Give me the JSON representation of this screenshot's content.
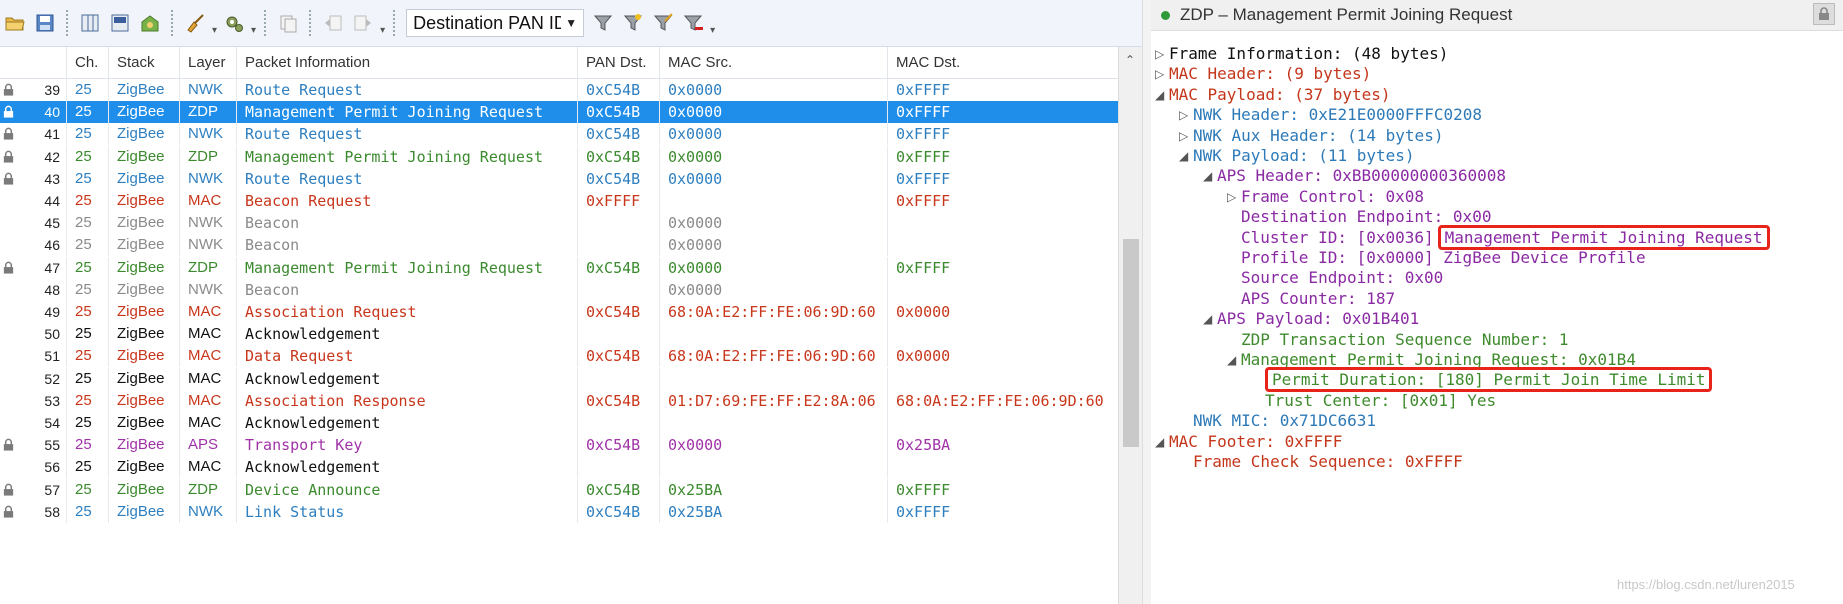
{
  "toolbar": {
    "pan_selector_value": "Destination PAN ID",
    "pan_selector_display": "Destination PAN ID"
  },
  "columns": {
    "ch": "Ch.",
    "stack": "Stack",
    "layer": "Layer",
    "info": "Packet Information",
    "pan_dst": "PAN Dst.",
    "mac_src": "MAC Src.",
    "mac_dst": "MAC Dst."
  },
  "packets": [
    {
      "num": "39",
      "ch": "25",
      "stack": "ZigBee",
      "layer": "NWK",
      "info": "Route Request",
      "pan": "0xC54B",
      "src": "0x0000",
      "dst": "0xFFFF",
      "locked": true,
      "kind": "nwk"
    },
    {
      "num": "40",
      "ch": "25",
      "stack": "ZigBee",
      "layer": "ZDP",
      "info": "Management Permit Joining Request",
      "pan": "0xC54B",
      "src": "0x0000",
      "dst": "0xFFFF",
      "locked": true,
      "kind": "zdp",
      "selected": true
    },
    {
      "num": "41",
      "ch": "25",
      "stack": "ZigBee",
      "layer": "NWK",
      "info": "Route Request",
      "pan": "0xC54B",
      "src": "0x0000",
      "dst": "0xFFFF",
      "locked": true,
      "kind": "nwk"
    },
    {
      "num": "42",
      "ch": "25",
      "stack": "ZigBee",
      "layer": "ZDP",
      "info": "Management Permit Joining Request",
      "pan": "0xC54B",
      "src": "0x0000",
      "dst": "0xFFFF",
      "locked": true,
      "kind": "zdp"
    },
    {
      "num": "43",
      "ch": "25",
      "stack": "ZigBee",
      "layer": "NWK",
      "info": "Route Request",
      "pan": "0xC54B",
      "src": "0x0000",
      "dst": "0xFFFF",
      "locked": true,
      "kind": "nwk"
    },
    {
      "num": "44",
      "ch": "25",
      "stack": "ZigBee",
      "layer": "MAC",
      "info": "Beacon Request",
      "pan": "0xFFFF",
      "src": "",
      "dst": "0xFFFF",
      "locked": false,
      "kind": "mac"
    },
    {
      "num": "45",
      "ch": "25",
      "stack": "ZigBee",
      "layer": "NWK",
      "info": "Beacon",
      "pan": "",
      "src": "0x0000",
      "dst": "",
      "locked": false,
      "kind": "gray"
    },
    {
      "num": "46",
      "ch": "25",
      "stack": "ZigBee",
      "layer": "NWK",
      "info": "Beacon",
      "pan": "",
      "src": "0x0000",
      "dst": "",
      "locked": false,
      "kind": "gray"
    },
    {
      "num": "47",
      "ch": "25",
      "stack": "ZigBee",
      "layer": "ZDP",
      "info": "Management Permit Joining Request",
      "pan": "0xC54B",
      "src": "0x0000",
      "dst": "0xFFFF",
      "locked": true,
      "kind": "zdp"
    },
    {
      "num": "48",
      "ch": "25",
      "stack": "ZigBee",
      "layer": "NWK",
      "info": "Beacon",
      "pan": "",
      "src": "0x0000",
      "dst": "",
      "locked": false,
      "kind": "gray"
    },
    {
      "num": "49",
      "ch": "25",
      "stack": "ZigBee",
      "layer": "MAC",
      "info": "Association Request",
      "pan": "0xC54B",
      "src": "68:0A:E2:FF:FE:06:9D:60",
      "dst": "0x0000",
      "locked": false,
      "kind": "mac"
    },
    {
      "num": "50",
      "ch": "25",
      "stack": "ZigBee",
      "layer": "MAC",
      "info": "Acknowledgement",
      "pan": "",
      "src": "",
      "dst": "",
      "locked": false,
      "kind": "black"
    },
    {
      "num": "51",
      "ch": "25",
      "stack": "ZigBee",
      "layer": "MAC",
      "info": "Data Request",
      "pan": "0xC54B",
      "src": "68:0A:E2:FF:FE:06:9D:60",
      "dst": "0x0000",
      "locked": false,
      "kind": "mac"
    },
    {
      "num": "52",
      "ch": "25",
      "stack": "ZigBee",
      "layer": "MAC",
      "info": "Acknowledgement",
      "pan": "",
      "src": "",
      "dst": "",
      "locked": false,
      "kind": "black"
    },
    {
      "num": "53",
      "ch": "25",
      "stack": "ZigBee",
      "layer": "MAC",
      "info": "Association Response",
      "pan": "0xC54B",
      "src": "01:D7:69:FE:FF:E2:8A:06",
      "dst": "68:0A:E2:FF:FE:06:9D:60",
      "locked": false,
      "kind": "mac"
    },
    {
      "num": "54",
      "ch": "25",
      "stack": "ZigBee",
      "layer": "MAC",
      "info": "Acknowledgement",
      "pan": "",
      "src": "",
      "dst": "",
      "locked": false,
      "kind": "black"
    },
    {
      "num": "55",
      "ch": "25",
      "stack": "ZigBee",
      "layer": "APS",
      "info": "Transport Key",
      "pan": "0xC54B",
      "src": "0x0000",
      "dst": "0x25BA",
      "locked": true,
      "kind": "aps"
    },
    {
      "num": "56",
      "ch": "25",
      "stack": "ZigBee",
      "layer": "MAC",
      "info": "Acknowledgement",
      "pan": "",
      "src": "",
      "dst": "",
      "locked": false,
      "kind": "black"
    },
    {
      "num": "57",
      "ch": "25",
      "stack": "ZigBee",
      "layer": "ZDP",
      "info": "Device Announce",
      "pan": "0xC54B",
      "src": "0x25BA",
      "dst": "0xFFFF",
      "locked": true,
      "kind": "zdp"
    },
    {
      "num": "58",
      "ch": "25",
      "stack": "ZigBee",
      "layer": "NWK",
      "info": "Link Status",
      "pan": "0xC54B",
      "src": "0x25BA",
      "dst": "0xFFFF",
      "locked": true,
      "kind": "nwk"
    }
  ],
  "details": {
    "title": "ZDP – Management Permit Joining Request",
    "tree": [
      {
        "text": "Frame Information: (48 bytes)",
        "color": "black",
        "level": 0,
        "toggle": "collapsed"
      },
      {
        "text": "MAC Header: (9 bytes)",
        "color": "red",
        "level": 0,
        "toggle": "collapsed"
      },
      {
        "text": "MAC Payload: (37 bytes)",
        "color": "red",
        "level": 0,
        "toggle": "expanded"
      },
      {
        "text": "NWK Header: 0xE21E0000FFFC0208",
        "color": "blue",
        "level": 1,
        "toggle": "collapsed"
      },
      {
        "text": "NWK Aux Header: (14 bytes)",
        "color": "blue",
        "level": 1,
        "toggle": "collapsed"
      },
      {
        "text": "NWK Payload: (11 bytes)",
        "color": "blue",
        "level": 1,
        "toggle": "expanded"
      },
      {
        "text": "APS Header: 0xBB00000000360008",
        "color": "purple",
        "level": 2,
        "toggle": "expanded"
      },
      {
        "text": "Frame Control: 0x08",
        "color": "purple",
        "level": 3,
        "toggle": "collapsed"
      },
      {
        "text": "Destination Endpoint: 0x00",
        "color": "purple",
        "level": 3,
        "toggle": "none"
      },
      {
        "text": "Cluster ID: [0x0036]",
        "hl": "Management Permit Joining Request",
        "color": "purple",
        "level": 3,
        "toggle": "none"
      },
      {
        "text": "Profile ID: [0x0000] ZigBee Device Profile",
        "color": "purple",
        "level": 3,
        "toggle": "none"
      },
      {
        "text": "Source Endpoint: 0x00",
        "color": "purple",
        "level": 3,
        "toggle": "none"
      },
      {
        "text": "APS Counter: 187",
        "color": "purple",
        "level": 3,
        "toggle": "none"
      },
      {
        "text": "APS Payload: 0x01B401",
        "color": "purple",
        "level": 2,
        "toggle": "expanded"
      },
      {
        "text": "ZDP Transaction Sequence Number: 1",
        "color": "green",
        "level": 3,
        "toggle": "none"
      },
      {
        "text": "Management Permit Joining Request: 0x01B4",
        "color": "green",
        "level": 3,
        "toggle": "expanded"
      },
      {
        "text": "",
        "hl": "Permit Duration: [180] Permit Join Time Limit",
        "color": "green",
        "level": 4,
        "toggle": "none"
      },
      {
        "text": "Trust Center: [0x01] Yes",
        "color": "green",
        "level": 4,
        "toggle": "none"
      },
      {
        "text": "NWK MIC: 0x71DC6631",
        "color": "blue",
        "level": 1,
        "toggle": "none"
      },
      {
        "text": "MAC Footer: 0xFFFF",
        "color": "red",
        "level": 0,
        "toggle": "expanded"
      },
      {
        "text": "Frame Check Sequence: 0xFFFF",
        "color": "red",
        "level": 1,
        "toggle": "none"
      }
    ]
  },
  "watermark": "https://blog.csdn.net/luren2015",
  "colors": {
    "selection": "#1e8eea",
    "nwk": "#2e7fc0",
    "zdp": "#3b8a2e",
    "mac": "#c8361b",
    "aps": "#a032a8",
    "highlight_box": "#e8231a"
  }
}
